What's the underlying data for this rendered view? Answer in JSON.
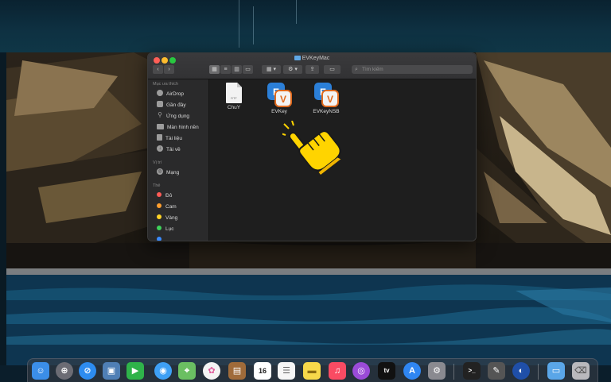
{
  "window": {
    "title": "EVKeyMac",
    "search_placeholder": "Tìm kiếm"
  },
  "sidebar": {
    "favorites_header": "Mục ưa thích",
    "favorites": [
      {
        "label": "AirDrop",
        "icon": "airdrop-icon"
      },
      {
        "label": "Gần đây",
        "icon": "recents-icon"
      },
      {
        "label": "Ứng dụng",
        "icon": "applications-icon"
      },
      {
        "label": "Màn hình nền",
        "icon": "desktop-icon"
      },
      {
        "label": "Tài liệu",
        "icon": "documents-icon"
      },
      {
        "label": "Tải về",
        "icon": "downloads-icon"
      }
    ],
    "locations_header": "Vị trí",
    "locations": [
      {
        "label": "Mạng",
        "icon": "network-icon"
      }
    ],
    "tags_header": "Thẻ",
    "tags": [
      {
        "label": "Đỏ",
        "color": "#ff5b56"
      },
      {
        "label": "Cam",
        "color": "#ff9f2e"
      },
      {
        "label": "Vàng",
        "color": "#ffd426"
      },
      {
        "label": "Lục",
        "color": "#3ed35a"
      }
    ]
  },
  "files": [
    {
      "name": "ChuY",
      "kind": "document",
      "ext": "RTF"
    },
    {
      "name": "EVKey",
      "kind": "app"
    },
    {
      "name": "EVKeyNSB",
      "kind": "app"
    }
  ],
  "dock": {
    "apps": [
      {
        "name": "finder-icon",
        "color": "#3b8ee8",
        "glyph": "☺"
      },
      {
        "name": "launchpad-icon",
        "color": "#6c6c74",
        "glyph": "🚀"
      },
      {
        "name": "safari-icon",
        "color": "#2d8cf0",
        "glyph": "⊘"
      },
      {
        "name": "preview-icon",
        "color": "#4f7fb5",
        "glyph": "▣"
      },
      {
        "name": "facetime-icon",
        "color": "#2fb34a",
        "glyph": "▶"
      },
      {
        "name": "messages-icon",
        "color": "#3ea0f5",
        "glyph": "💬"
      },
      {
        "name": "maps-icon",
        "color": "#6bbf62",
        "glyph": "⌖"
      },
      {
        "name": "photos-icon",
        "color": "#f4f4f4",
        "glyph": "✿"
      },
      {
        "name": "notes-brown-icon",
        "color": "#a06b3a",
        "glyph": "▤"
      },
      {
        "name": "calendar-icon",
        "color": "#ffffff",
        "glyph": "16"
      },
      {
        "name": "reminders-icon",
        "color": "#f6f6f6",
        "glyph": "☰"
      },
      {
        "name": "notes-icon",
        "color": "#f7d84a",
        "glyph": "▬"
      },
      {
        "name": "music-icon",
        "color": "#fa4b63",
        "glyph": "♫"
      },
      {
        "name": "podcasts-icon",
        "color": "#9a4bd8",
        "glyph": "◎"
      },
      {
        "name": "apple-tv-icon",
        "color": "#111111",
        "glyph": "tv"
      },
      {
        "name": "app-store-icon",
        "color": "#2f86f2",
        "glyph": "A"
      },
      {
        "name": "system-preferences-icon",
        "color": "#8a8a90",
        "glyph": "⚙"
      },
      {
        "name": "terminal-icon",
        "color": "#222222",
        "glyph": ">_"
      },
      {
        "name": "script-editor-icon",
        "color": "#555555",
        "glyph": "✎"
      },
      {
        "name": "browser-icon",
        "color": "#1f4fa8",
        "glyph": "◐"
      },
      {
        "name": "downloads-folder-icon",
        "color": "#5aa6e8",
        "glyph": "▭"
      },
      {
        "name": "trash-icon",
        "color": "#b9b9bd",
        "glyph": "🗑"
      }
    ],
    "calendar_day": "16"
  }
}
